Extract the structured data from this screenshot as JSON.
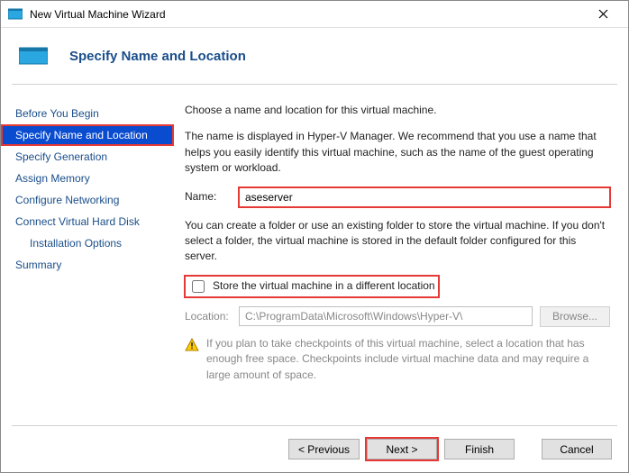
{
  "window": {
    "title": "New Virtual Machine Wizard"
  },
  "header": {
    "title": "Specify Name and Location"
  },
  "sidebar": {
    "items": [
      {
        "label": "Before You Begin"
      },
      {
        "label": "Specify Name and Location"
      },
      {
        "label": "Specify Generation"
      },
      {
        "label": "Assign Memory"
      },
      {
        "label": "Configure Networking"
      },
      {
        "label": "Connect Virtual Hard Disk"
      },
      {
        "label": "Installation Options"
      },
      {
        "label": "Summary"
      }
    ]
  },
  "main": {
    "intro": "Choose a name and location for this virtual machine.",
    "desc": "The name is displayed in Hyper-V Manager. We recommend that you use a name that helps you easily identify this virtual machine, such as the name of the guest operating system or workload.",
    "name_label": "Name:",
    "name_value": "aseserver",
    "folder_desc": "You can create a folder or use an existing folder to store the virtual machine. If you don't select a folder, the virtual machine is stored in the default folder configured for this server.",
    "checkbox_label": "Store the virtual machine in a different location",
    "location_label": "Location:",
    "location_value": "C:\\ProgramData\\Microsoft\\Windows\\Hyper-V\\",
    "browse_label": "Browse...",
    "warn_text": "If you plan to take checkpoints of this virtual machine, select a location that has enough free space. Checkpoints include virtual machine data and may require a large amount of space."
  },
  "footer": {
    "previous": "< Previous",
    "next": "Next >",
    "finish": "Finish",
    "cancel": "Cancel"
  }
}
